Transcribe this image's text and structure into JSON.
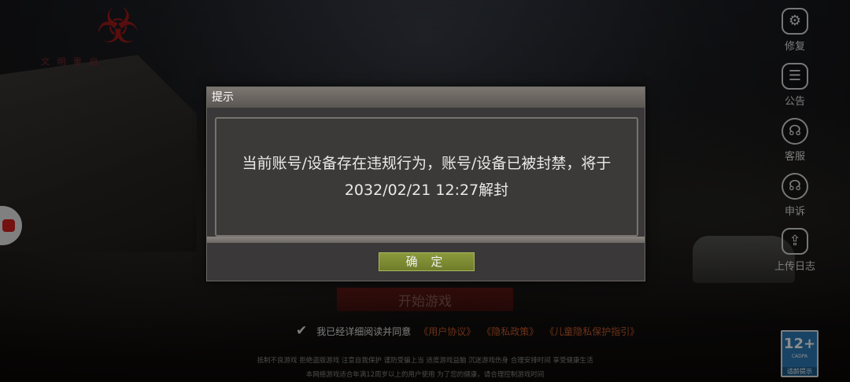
{
  "logo": {
    "text": "文 明 重 启"
  },
  "right_menu": [
    {
      "label": "修复",
      "icon": "gear-icon"
    },
    {
      "label": "公告",
      "icon": "notice-icon"
    },
    {
      "label": "客服",
      "icon": "headset-icon"
    },
    {
      "label": "申诉",
      "icon": "headset-icon"
    },
    {
      "label": "上传日志",
      "icon": "upload-icon"
    }
  ],
  "start_button": "开始游戏",
  "agreement": {
    "text": "我已经详细阅读并同意",
    "links": [
      "《用户协议》",
      "《隐私政策》",
      "《儿童隐私保护指引》"
    ]
  },
  "footer": {
    "line1": "抵制不良游戏 拒绝盗版游戏 注意自我保护 谨防受骗上当 适度游戏益脑 沉迷游戏伤身 合理安排时间 享受健康生活",
    "line2": "本网络游戏适合年满12周岁以上的用户使用    为了您的健康，请合理控制游戏时间"
  },
  "age_badge": {
    "age": "12+",
    "sub": "CADPA",
    "tip": "适龄提示"
  },
  "dialog": {
    "title": "提示",
    "message": "当前账号/设备存在违规行为，账号/设备已被封禁，将于2032/02/21 12:27解封",
    "confirm": "确 定"
  }
}
